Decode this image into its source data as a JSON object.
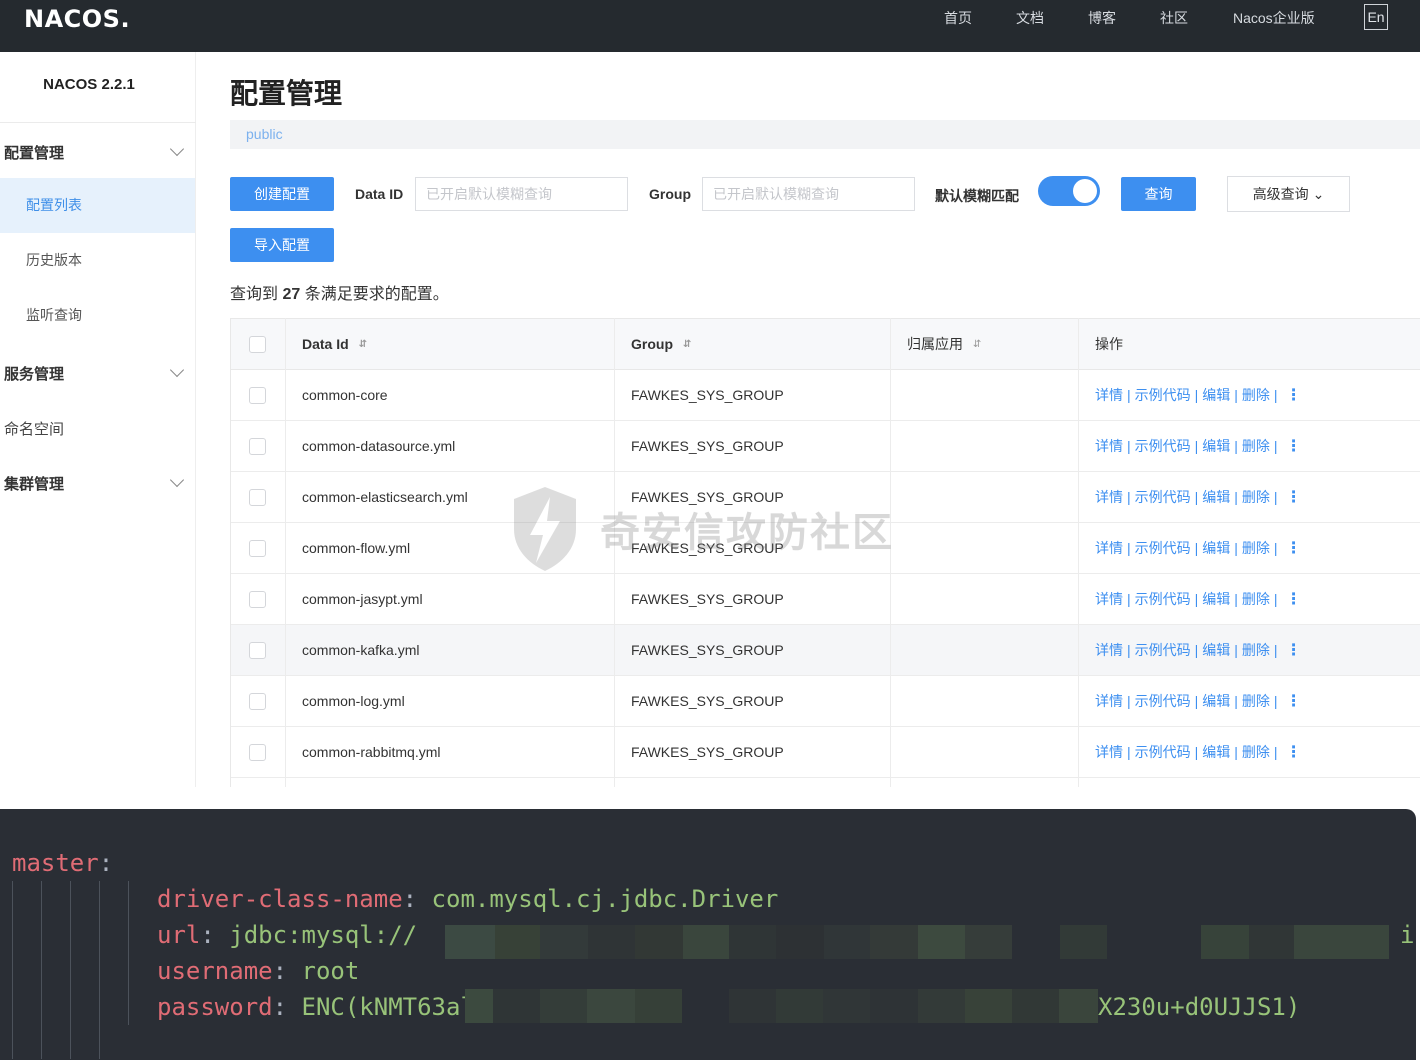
{
  "header": {
    "logo": "NACOS.",
    "nav": [
      "首页",
      "文档",
      "博客",
      "社区",
      "Nacos企业版"
    ],
    "lang": "En"
  },
  "sidebar": {
    "version": "NACOS 2.2.1",
    "groups": [
      {
        "label": "配置管理",
        "items": [
          "配置列表",
          "历史版本",
          "监听查询"
        ]
      },
      {
        "label": "服务管理"
      },
      {
        "label": "命名空间"
      },
      {
        "label": "集群管理"
      }
    ]
  },
  "main": {
    "title": "配置管理",
    "namespace": "public",
    "create_btn": "创建配置",
    "import_btn": "导入配置",
    "dataid_label": "Data ID",
    "dataid_placeholder": "已开启默认模糊查询",
    "group_label": "Group",
    "group_placeholder": "已开启默认模糊查询",
    "fuzzy_label": "默认模糊匹配",
    "fuzzy_on": true,
    "query_btn": "查询",
    "advanced_btn": "高级查询 ⌄",
    "result_prefix": "查询到",
    "result_count": "27",
    "result_suffix": "条满足要求的配置。"
  },
  "table": {
    "headers": [
      "Data Id",
      "Group",
      "归属应用",
      "操作"
    ],
    "sort_icon": "⇵",
    "actions": [
      "详情",
      "示例代码",
      "编辑",
      "删除"
    ],
    "rows": [
      {
        "data_id": "common-core",
        "group": "FAWKES_SYS_GROUP",
        "app": ""
      },
      {
        "data_id": "common-datasource.yml",
        "group": "FAWKES_SYS_GROUP",
        "app": ""
      },
      {
        "data_id": "common-elasticsearch.yml",
        "group": "FAWKES_SYS_GROUP",
        "app": ""
      },
      {
        "data_id": "common-flow.yml",
        "group": "FAWKES_SYS_GROUP",
        "app": ""
      },
      {
        "data_id": "common-jasypt.yml",
        "group": "FAWKES_SYS_GROUP",
        "app": ""
      },
      {
        "data_id": "common-kafka.yml",
        "group": "FAWKES_SYS_GROUP",
        "app": ""
      },
      {
        "data_id": "common-log.yml",
        "group": "FAWKES_SYS_GROUP",
        "app": ""
      },
      {
        "data_id": "common-rabbitmq.yml",
        "group": "FAWKES_SYS_GROUP",
        "app": ""
      }
    ]
  },
  "watermark": "奇安信攻防社区",
  "code": {
    "root_key": "master",
    "driver_key": "driver-class-name",
    "driver_val": "com.mysql.cj.jdbc.Driver",
    "url_key": "url",
    "url_val": "jdbc:mysql://",
    "url_tail": "in",
    "user_key": "username",
    "user_val": "root",
    "pass_key": "password",
    "pass_head": "ENC(kNMT63al",
    "pass_tail": "X230u+d0UJJS1)"
  },
  "colors": {
    "accent": "#3d8ff0",
    "topbar": "#252a2f",
    "code_bg": "#2a2e35",
    "code_key": "#e06c75",
    "code_val": "#98c379"
  }
}
